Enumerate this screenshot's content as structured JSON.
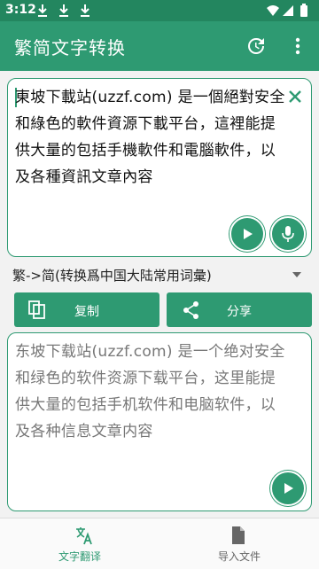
{
  "status_bar": {
    "time": "3:12"
  },
  "app_bar": {
    "title": "繁简文字转换"
  },
  "input": {
    "text": "東坡下載站(uzzf.com) 是一個絕對安全和綠色的軟件資源下載平台，這裡能提供大量的包括手機軟件和電腦軟件，以及各種資訊文章內容"
  },
  "mode": {
    "selected": "繁->简(转换爲中国大陆常用词彙)"
  },
  "actions": {
    "copy_label": "复制",
    "share_label": "分享"
  },
  "output": {
    "text": "东坡下载站(uzzf.com) 是一个绝对安全和绿色的软件资源下载平台，这里能提供大量的包括手机软件和电脑软件，以及各种信息文章内容"
  },
  "bottom_nav": {
    "items": [
      {
        "label": "文字翻译",
        "icon": "translate-icon",
        "active": true
      },
      {
        "label": "导入文件",
        "icon": "file-icon",
        "active": false
      }
    ]
  },
  "colors": {
    "primary": "#2e9a72",
    "status_bar": "#23865f",
    "inactive": "#666666"
  }
}
